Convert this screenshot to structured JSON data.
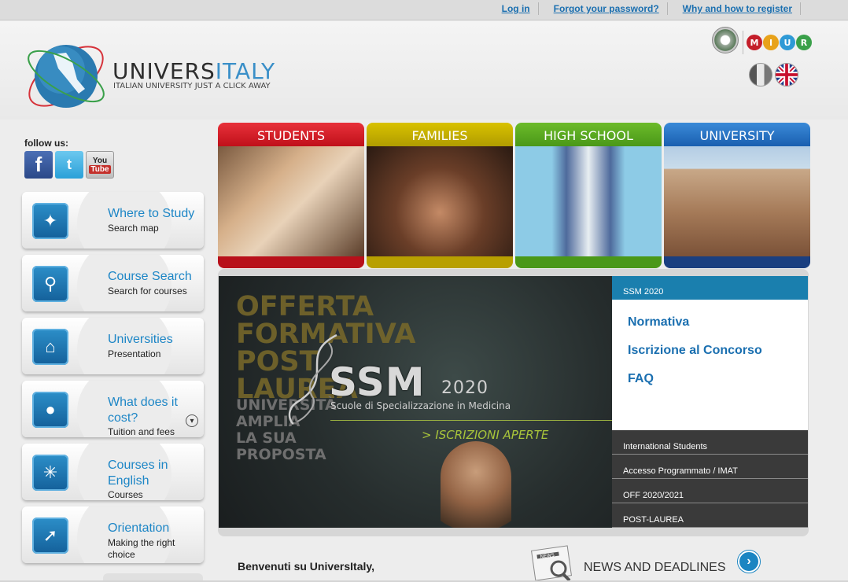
{
  "top_links": [
    "Log in",
    "Forgot your password?",
    "Why and how to register"
  ],
  "logo": {
    "name_prefix": "UNIVERS",
    "name_suffix": "ITALY",
    "tagline": "ITALIAN UNIVERSITY JUST A CLICK AWAY"
  },
  "miur_letters": [
    "M",
    "I",
    "U",
    "R"
  ],
  "follow_us": "follow us:",
  "social": {
    "facebook": "f",
    "twitter": "t",
    "youtube_top": "You",
    "youtube_bottom": "Tube"
  },
  "sidebar": [
    {
      "title": "Where to Study",
      "subtitle": "Search map",
      "icon": "compass-icon"
    },
    {
      "title": "Course Search",
      "subtitle": "Search for courses",
      "icon": "magnifier-icon"
    },
    {
      "title": "Universities",
      "subtitle": "Presentation",
      "icon": "building-icon"
    },
    {
      "title": "What does it cost?",
      "subtitle": "Tuition and fees",
      "icon": "piggy-bank-icon"
    },
    {
      "title": "Courses in English",
      "subtitle": "Courses",
      "icon": "union-jack-icon"
    },
    {
      "title": "Orientation",
      "subtitle": "Making the right choice",
      "icon": "arrow-turn-icon"
    }
  ],
  "tiles": [
    {
      "label": "STUDENTS",
      "color": "#d4141e"
    },
    {
      "label": "FAMILIES",
      "color": "#c8b400"
    },
    {
      "label": "HIGH SCHOOL",
      "color": "#5aa61e"
    },
    {
      "label": "UNIVERSITY",
      "color": "#1e6fc0"
    }
  ],
  "banner": {
    "offerta": [
      "OFFERTA",
      "FORMATIVA",
      "POST",
      "LAUREA"
    ],
    "universita": [
      "UNIVERSITÀ",
      "AMPLIA",
      "LA SUA",
      "PROPOSTA"
    ],
    "ssm": "SSM",
    "year": "2020",
    "scuole": "Scuole di Specializzazione in Medicina",
    "iscrizioni": "> ISCRIZIONI APERTE"
  },
  "panel": {
    "header": "SSM 2020",
    "links": [
      "Normativa",
      "Iscrizione al Concorso",
      "FAQ"
    ],
    "list": [
      "International Students",
      "Accesso Programmato / IMAT",
      "OFF 2020/2021",
      "POST-LAUREA"
    ]
  },
  "welcome": "Benvenuti su UniversItaly,",
  "news": {
    "label": "NEWS AND DEADLINES",
    "icon_text": "NEWS"
  }
}
